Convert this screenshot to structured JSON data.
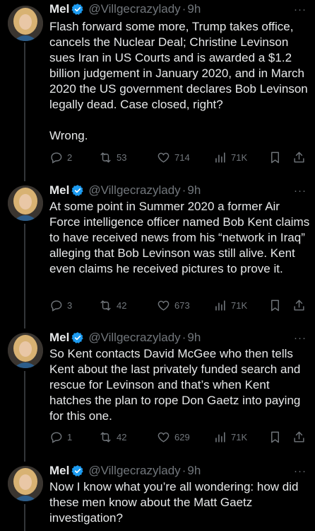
{
  "author": {
    "name": "Mel",
    "handle": "@Villgecrazylady",
    "separator": "·",
    "time": "9h",
    "more": "···",
    "verified_color": "#1d9bf0"
  },
  "tweets": [
    {
      "paragraphs": [
        "Flash forward some more, Trump takes office, cancels the Nuclear Deal; Christine Levinson sues Iran in US Courts and is awarded a $1.2 billion judgement in January 2020, and in March 2020 the US government declares Bob Levinson legally dead. Case closed, right?",
        "Wrong."
      ],
      "replies": "2",
      "reposts": "53",
      "likes": "714",
      "views": "71K"
    },
    {
      "paragraphs": [
        "At some point in Summer 2020 a former Air Force intelligence officer named Bob Kent claims to have received news from his “network in Iraq” alleging that Bob Levinson was still alive. Kent even claims he received pictures to prove it."
      ],
      "replies": "3",
      "reposts": "42",
      "likes": "673",
      "views": "71K"
    },
    {
      "paragraphs": [
        "So Kent contacts David McGee who then tells Kent about the last privately funded search and rescue for Levinson and that’s when Kent hatches the plan to rope Don Gaetz into paying for this one."
      ],
      "replies": "1",
      "reposts": "42",
      "likes": "629",
      "views": "71K"
    },
    {
      "paragraphs": [
        "Now I know what you’re all wondering: how did these men know about the Matt Gaetz investigation?"
      ]
    }
  ],
  "icons": {
    "reply": "reply-icon",
    "repost": "repost-icon",
    "like": "heart-icon",
    "views": "views-icon",
    "bookmark": "bookmark-icon",
    "share": "share-icon"
  }
}
